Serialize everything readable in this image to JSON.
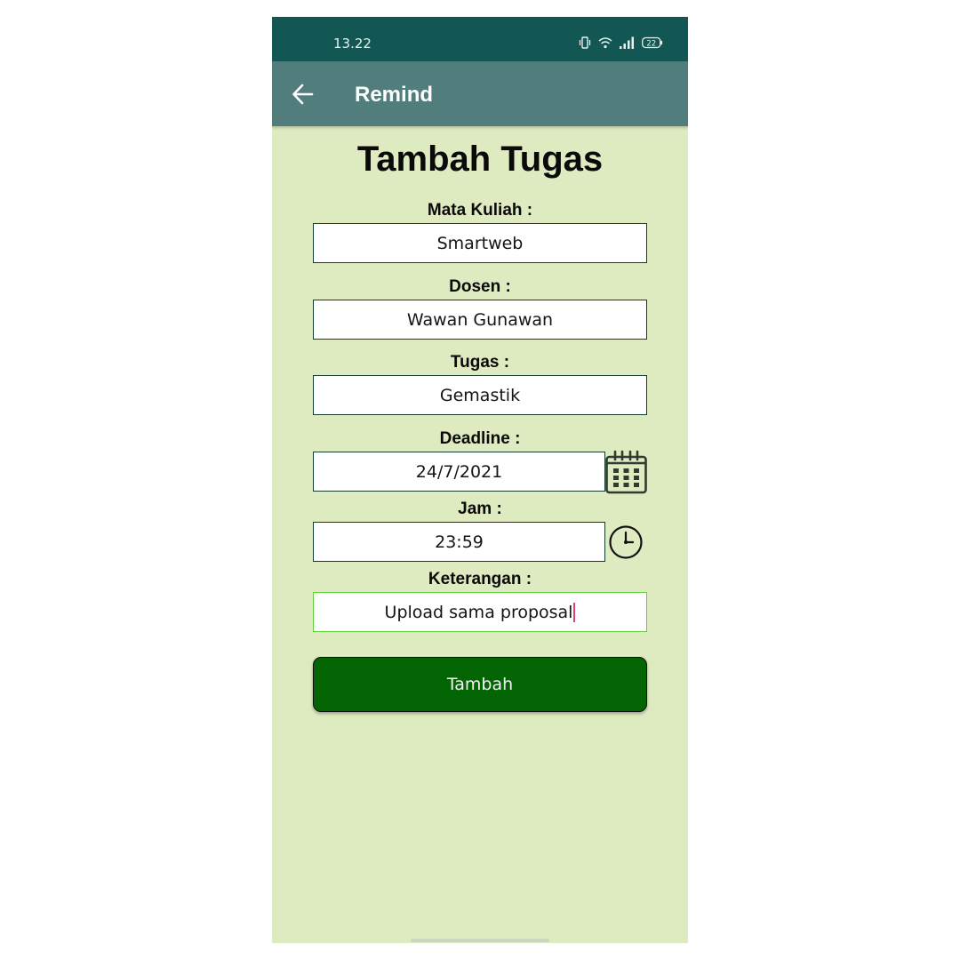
{
  "status_bar": {
    "time": "13.22",
    "battery": "22",
    "icons": [
      "vibrate-icon",
      "wifi-icon",
      "signal-icon",
      "battery-icon"
    ]
  },
  "app_bar": {
    "title": "Remind",
    "back_icon": "arrow-left-icon"
  },
  "form": {
    "heading": "Tambah Tugas",
    "mata_kuliah": {
      "label": "Mata Kuliah :",
      "value": "Smartweb"
    },
    "dosen": {
      "label": "Dosen :",
      "value": "Wawan Gunawan"
    },
    "tugas": {
      "label": "Tugas :",
      "value": "Gemastik"
    },
    "deadline": {
      "label": "Deadline :",
      "value": "24/7/2021",
      "icon": "calendar-icon"
    },
    "jam": {
      "label": "Jam :",
      "value": "23:59",
      "icon": "clock-icon"
    },
    "keterangan": {
      "label": "Keterangan :",
      "value": "Upload sama proposal"
    },
    "submit_label": "Tambah"
  },
  "colors": {
    "status_bar": "#135754",
    "app_bar": "#527d7d",
    "background": "#deeac0",
    "button": "#036403",
    "focus_border": "#63cf3f",
    "caret": "#e2406c"
  }
}
